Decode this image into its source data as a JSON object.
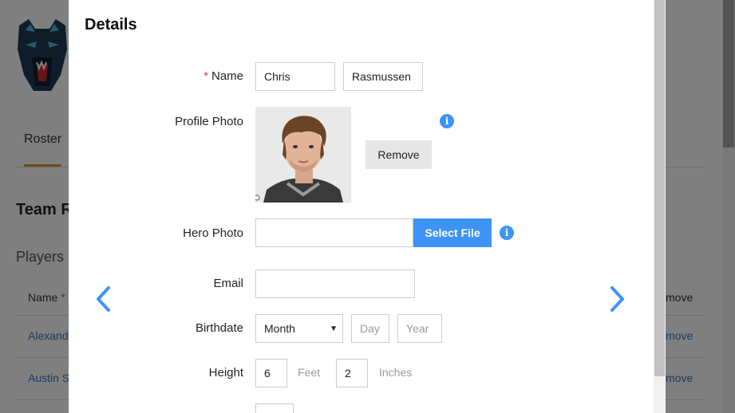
{
  "background": {
    "tab_roster": "Roster",
    "team_heading": "Team R",
    "players_heading": "Players",
    "col_name": "Name",
    "col_name_required": "*",
    "col_remove": "move",
    "rows": [
      {
        "name": "Alexand",
        "remove": "move"
      },
      {
        "name": "Austin S",
        "remove": "move"
      }
    ]
  },
  "modal": {
    "title": "Details",
    "name": {
      "required_mark": "*",
      "label": "Name",
      "first": "Chris",
      "last": "Rasmussen"
    },
    "profile_photo": {
      "label": "Profile Photo",
      "remove_label": "Remove",
      "info_icon": "info-icon"
    },
    "hero_photo": {
      "label": "Hero Photo",
      "file_value": "",
      "select_label": "Select File",
      "info_icon": "info-icon"
    },
    "email": {
      "label": "Email",
      "value": ""
    },
    "birthdate": {
      "label": "Birthdate",
      "month_selected": "Month",
      "day_placeholder": "Day",
      "year_placeholder": "Year"
    },
    "height": {
      "label": "Height",
      "feet": "6",
      "feet_unit": "Feet",
      "inches": "2",
      "inches_unit": "Inches"
    },
    "nav": {
      "prev_icon": "chevron-left-icon",
      "next_icon": "chevron-right-icon"
    }
  },
  "colors": {
    "accent": "#3d94f6",
    "required": "#e03a3a",
    "tab_underline": "#d4a030"
  }
}
